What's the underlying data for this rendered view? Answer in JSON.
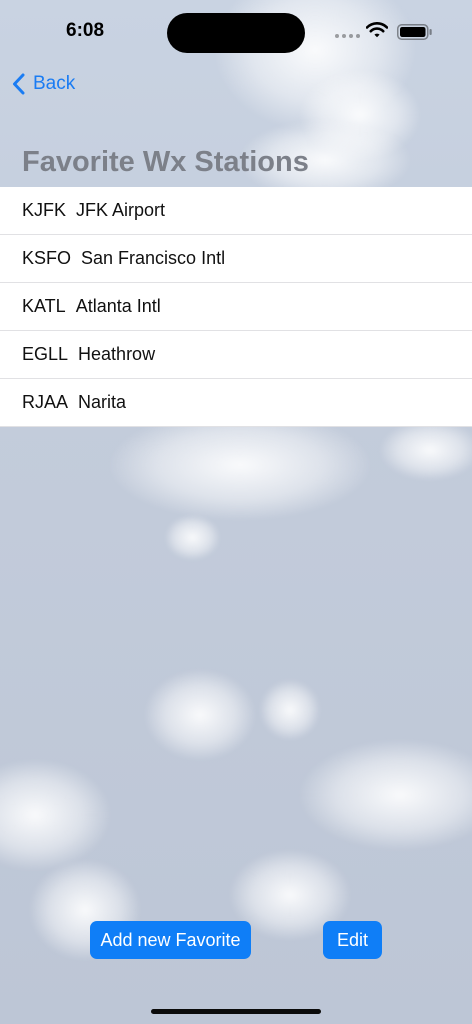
{
  "status_bar": {
    "time": "6:08"
  },
  "nav": {
    "back_label": "Back",
    "back_icon": "chevron-left-icon",
    "accent_color": "#1a7cf3"
  },
  "page": {
    "title": "Favorite Wx Stations"
  },
  "stations": [
    {
      "code": "KJFK",
      "name": "JFK Airport"
    },
    {
      "code": "KSFO",
      "name": "San Francisco Intl"
    },
    {
      "code": "KATL",
      "name": "Atlanta Intl"
    },
    {
      "code": "EGLL",
      "name": "Heathrow"
    },
    {
      "code": "RJAA",
      "name": "Narita"
    }
  ],
  "actions": {
    "add_label": "Add new Favorite",
    "edit_label": "Edit",
    "button_color": "#0f7ef7"
  }
}
